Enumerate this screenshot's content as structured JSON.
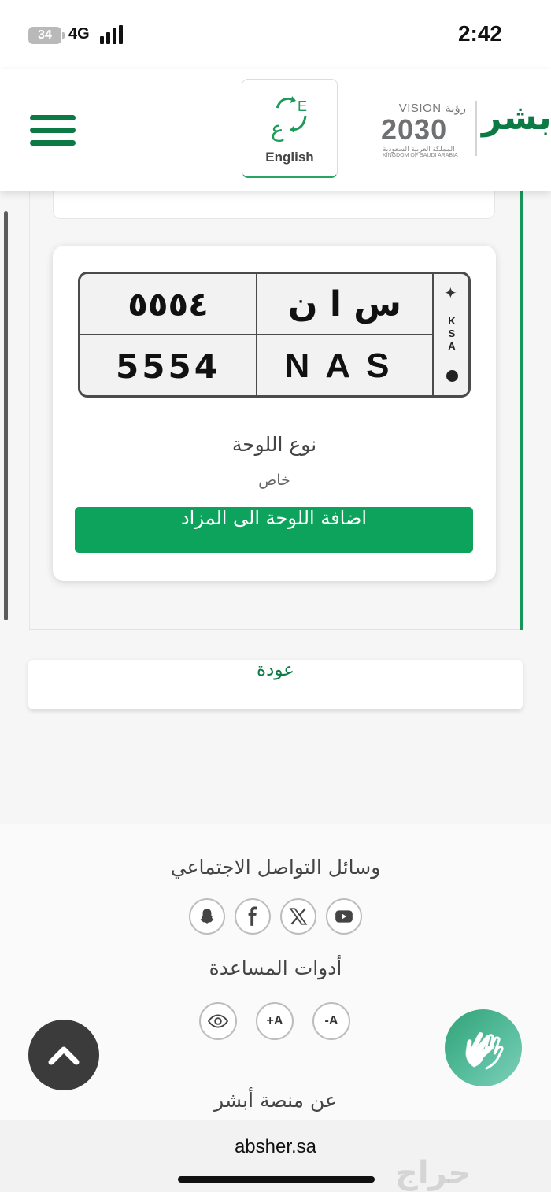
{
  "status_bar": {
    "battery": "34",
    "network": "4G",
    "time": "2:42"
  },
  "header": {
    "language_button": "English",
    "vision_label": "VISION",
    "vision_arabic": "رؤية",
    "vision_year": "2030",
    "vision_country_ar": "المملكة العربية السعودية",
    "vision_country_en": "KINGDOM OF SAUDI ARABIA",
    "brand": "أبشر"
  },
  "plate": {
    "numbers_ar": "٥٥٥٤",
    "letters_ar": "س ا ن",
    "numbers_en": "5554",
    "letters_en": "NAS",
    "country_code": "KSA",
    "type_title": "نوع اللوحة",
    "type_value": "خاص",
    "add_button": "اضافة اللوحة الى المزاد"
  },
  "back_button": "عودة",
  "footer": {
    "social_title": "وسائل التواصل الاجتماعي",
    "social_icons": [
      "snapchat-icon",
      "facebook-icon",
      "x-icon",
      "youtube-icon"
    ],
    "help_title": "أدوات المساعدة",
    "help_tools": {
      "decrease": "A-",
      "increase": "A+"
    },
    "about_title": "عن منصة أبشر"
  },
  "url_bar": {
    "url": "absher.sa",
    "watermark": "حراج"
  },
  "colors": {
    "brand_green": "#0b7a45",
    "button_green": "#0ea35c",
    "accent_line": "#16965a"
  }
}
